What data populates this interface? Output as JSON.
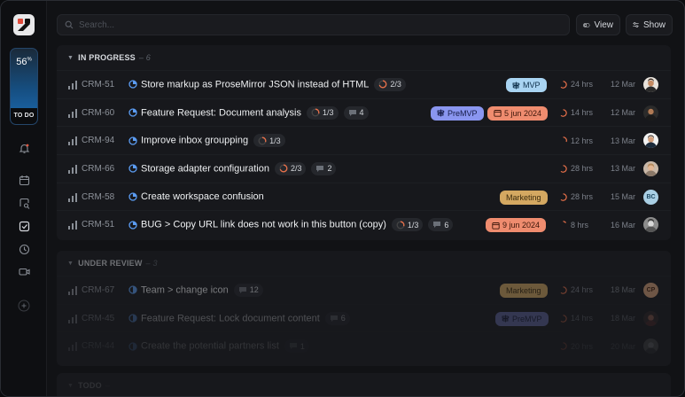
{
  "sidebar": {
    "progress_percent": "56",
    "progress_symbol": "%",
    "progress_label": "TO DO"
  },
  "search": {
    "placeholder": "Search..."
  },
  "toolbar": {
    "view_label": "View",
    "show_label": "Show"
  },
  "sections": [
    {
      "name": "IN PROGRESS",
      "count": "6",
      "rows": [
        {
          "id": "CRM-51",
          "title": "Store markup as ProseMirror JSON instead of HTML",
          "progress": "2/3",
          "comments": "",
          "tag": "MVP",
          "tag_type": "mvp",
          "date_tag": "",
          "hours": "24 hrs",
          "date": "12 Mar",
          "avatar": "photo-1"
        },
        {
          "id": "CRM-60",
          "title": "Feature Request: Document analysis",
          "progress": "1/3",
          "comments": "4",
          "tag": "PreMVP",
          "tag_type": "premvp",
          "date_tag": "5 jun 2024",
          "hours": "14 hrs",
          "date": "12 Mar",
          "avatar": "photo-2"
        },
        {
          "id": "CRM-94",
          "title": "Improve inbox groupping",
          "progress": "1/3",
          "comments": "",
          "tag": "",
          "tag_type": "",
          "date_tag": "",
          "hours": "12 hrs",
          "date": "13 Mar",
          "avatar": "photo-3"
        },
        {
          "id": "CRM-66",
          "title": "Storage adapter configuration",
          "progress": "2/3",
          "comments": "2",
          "tag": "",
          "tag_type": "",
          "date_tag": "",
          "hours": "28 hrs",
          "date": "13 Mar",
          "avatar": "photo-4"
        },
        {
          "id": "CRM-58",
          "title": "Create workspace confusion",
          "progress": "",
          "comments": "",
          "tag": "Marketing",
          "tag_type": "marketing",
          "date_tag": "",
          "hours": "28 hrs",
          "date": "15 Mar",
          "avatar": "BC"
        },
        {
          "id": "CRM-51",
          "title": "BUG > Copy URL link does not work in this button (copy)",
          "progress": "1/3",
          "comments": "6",
          "tag": "",
          "tag_type": "",
          "date_tag": "9 jun 2024",
          "hours": "8 hrs",
          "date": "16 Mar",
          "avatar": "photo-5"
        }
      ]
    },
    {
      "name": "UNDER REVIEW",
      "count": "3",
      "rows": [
        {
          "id": "CRM-67",
          "title": "Team > change icon",
          "progress": "",
          "comments": "12",
          "tag": "Marketing",
          "tag_type": "marketing",
          "date_tag": "",
          "hours": "24 hrs",
          "date": "18 Mar",
          "avatar": "CP"
        },
        {
          "id": "CRM-45",
          "title": "Feature Request: Lock document content",
          "progress": "",
          "comments": "6",
          "tag": "PreMVP",
          "tag_type": "premvp",
          "date_tag": "",
          "hours": "14 hrs",
          "date": "18 Mar",
          "avatar": "photo-6"
        },
        {
          "id": "CRM-44",
          "title": "Create the potential partners list",
          "progress": "",
          "comments": "1",
          "tag": "",
          "tag_type": "",
          "date_tag": "",
          "hours": "20 hrs",
          "date": "20 Mar",
          "avatar": "photo-7"
        }
      ]
    },
    {
      "name": "TODO",
      "count": "",
      "rows": []
    }
  ],
  "colors": {
    "accent_blue": "#5b9cf2",
    "mvp": "#a9d4f2",
    "premvp": "#8a96f0",
    "marketing": "#d4a861",
    "date_tag": "#ef8c6f",
    "progress_ring": "#e8704a"
  }
}
